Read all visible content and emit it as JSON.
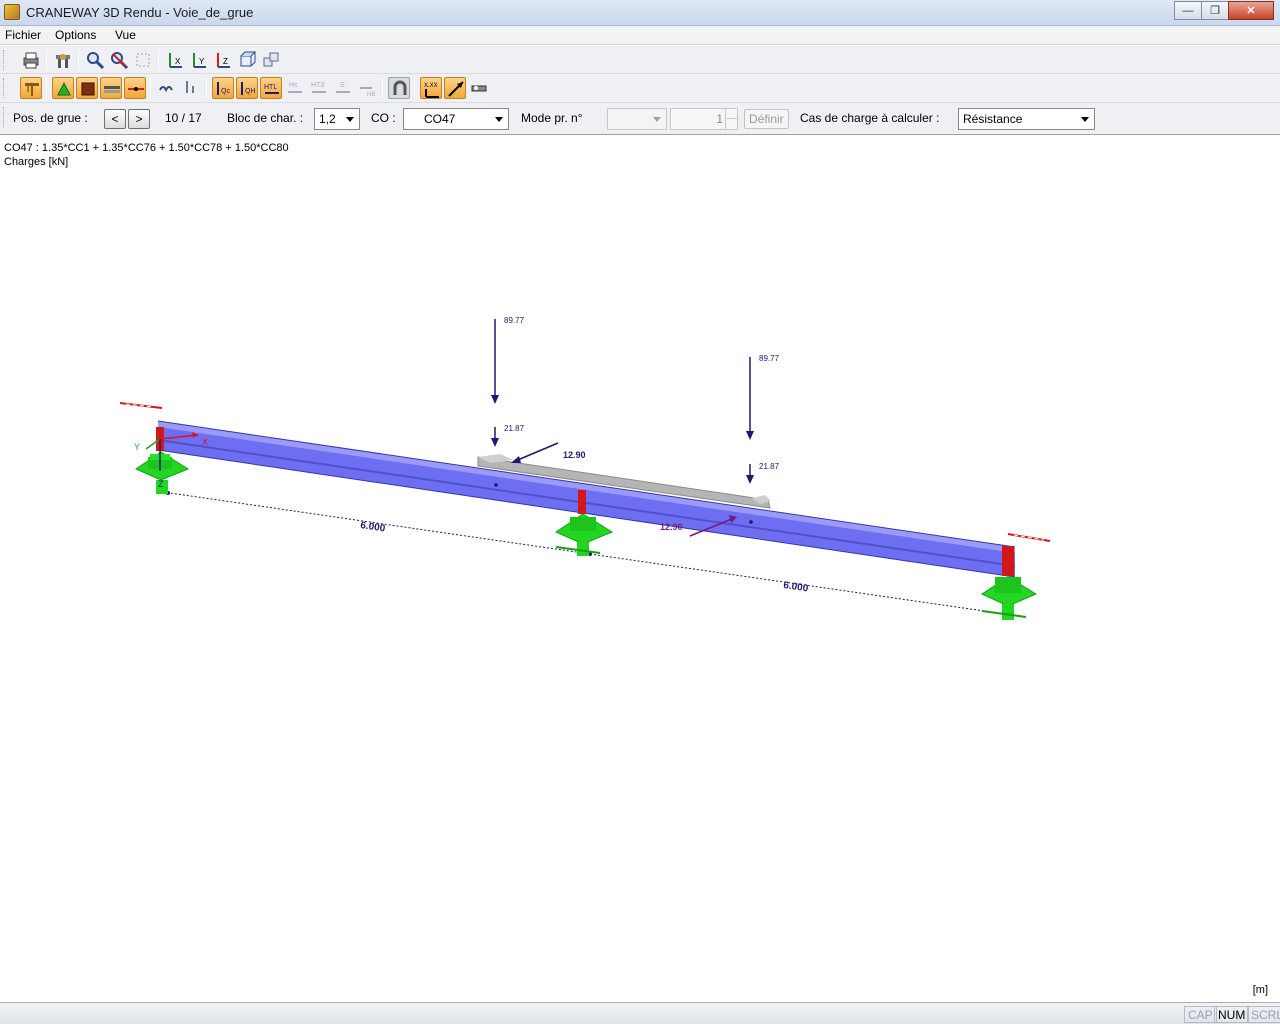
{
  "window": {
    "title": "CRANEWAY 3D Rendu - Voie_de_grue"
  },
  "menu": [
    "Fichier",
    "Options",
    "Vue"
  ],
  "controls": {
    "pos_label": "Pos. de grue :",
    "prev": "<",
    "next": ">",
    "pos_value": "10 / 17",
    "bloc_label": "Bloc de char. :",
    "bloc_value": "1,2",
    "co_label": "CO :",
    "co_value": "CO47",
    "mode_label": "Mode pr. n°",
    "mode_value": "",
    "mode_spin": "1",
    "definir": "Définir",
    "cas_label": "Cas de charge à calculer :",
    "cas_value": "Résistance"
  },
  "view": {
    "combo_line": "CO47 : 1.35*CC1 + 1.35*CC76 + 1.50*CC78 + 1.50*CC80",
    "units_line": "Charges [kN]",
    "unit_corner": "[m]",
    "loads": {
      "v1_top": "89.77",
      "v1_bottom": "21.87",
      "h1": "12.90",
      "v2_top": "89.77",
      "v2_bottom": "21.87",
      "h2": "12.90"
    },
    "dimensions": {
      "span1": "6.000",
      "span2": "6.000"
    },
    "axes": {
      "x": "X",
      "y": "Y",
      "z": "Z"
    },
    "colors": {
      "beam": "#6e6ef2",
      "support": "#22d622",
      "load": "#1a1a6e",
      "rail": "#b5b5b5",
      "stiffener": "#d01818"
    }
  },
  "status": [
    "CAP",
    "NUM",
    "SCRL"
  ]
}
